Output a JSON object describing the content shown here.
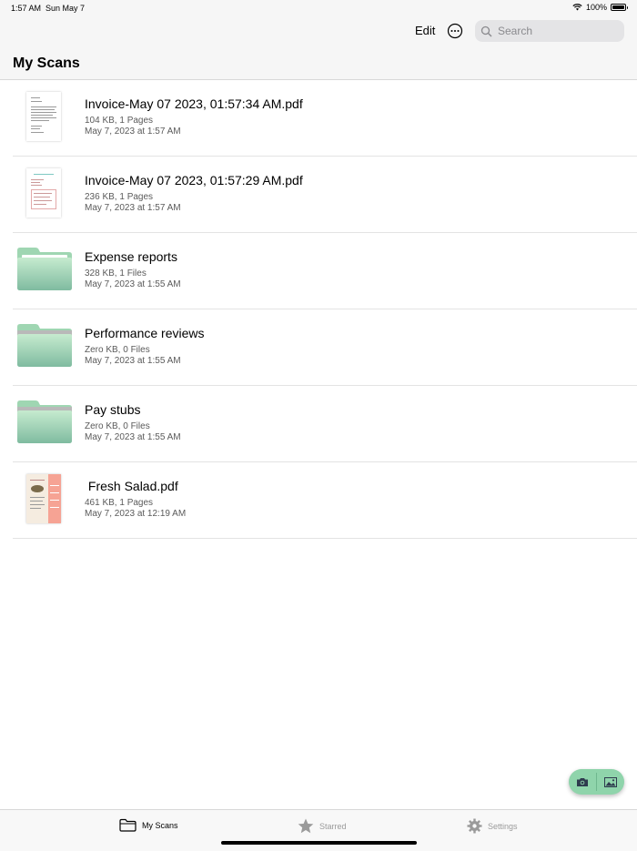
{
  "status_bar": {
    "time": "1:57 AM",
    "date": "Sun May 7",
    "battery": "100%"
  },
  "toolbar": {
    "edit_label": "Edit",
    "more_icon": "ellipsis-circle-icon",
    "search_placeholder": "Search"
  },
  "page": {
    "title": "My Scans"
  },
  "items": [
    {
      "kind": "pdf",
      "name": "Invoice-May 07 2023, 01:57:34 AM.pdf",
      "meta": "104 KB, 1 Pages",
      "date": "May 7, 2023 at 1:57 AM"
    },
    {
      "kind": "pdf",
      "name": "Invoice-May 07 2023, 01:57:29 AM.pdf",
      "meta": "236 KB, 1 Pages",
      "date": "May 7, 2023 at 1:57 AM"
    },
    {
      "kind": "folder",
      "name": "Expense reports",
      "meta": "328 KB, 1 Files",
      "date": "May 7, 2023 at 1:55 AM"
    },
    {
      "kind": "folder",
      "name": "Performance reviews",
      "meta": "Zero KB, 0 Files",
      "date": "May 7, 2023 at 1:55 AM"
    },
    {
      "kind": "folder",
      "name": "Pay stubs",
      "meta": "Zero KB, 0 Files",
      "date": "May 7, 2023 at 1:55 AM"
    },
    {
      "kind": "pdf",
      "name": " Fresh Salad.pdf",
      "meta": "461 KB, 1 Pages",
      "date": "May 7, 2023 at 12:19 AM"
    }
  ],
  "fab": {
    "camera_icon": "camera-icon",
    "photos_icon": "photo-icon",
    "color": "#8fd4ab"
  },
  "tabs": [
    {
      "label": "My Scans",
      "icon": "folder-icon",
      "active": true
    },
    {
      "label": "Starred",
      "icon": "star-icon",
      "active": false
    },
    {
      "label": "Settings",
      "icon": "gear-icon",
      "active": false
    }
  ],
  "colors": {
    "folder_top": "#bfe8c9",
    "folder_bottom": "#7fbfa3",
    "inactive_tab": "#9a9a9a"
  }
}
